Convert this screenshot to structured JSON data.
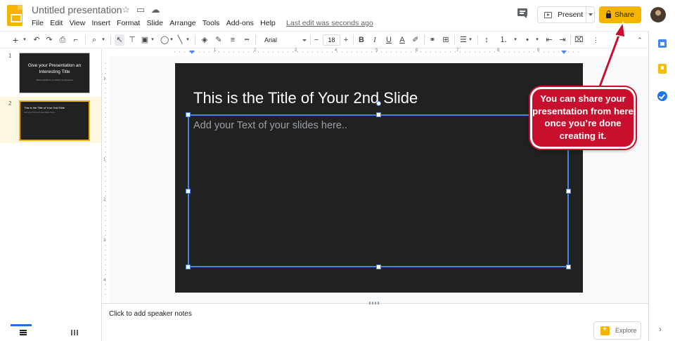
{
  "header": {
    "title": "Untitled presentation",
    "menu": [
      "File",
      "Edit",
      "View",
      "Insert",
      "Format",
      "Slide",
      "Arrange",
      "Tools",
      "Add-ons",
      "Help"
    ],
    "last_edit": "Last edit was seconds ago",
    "present_label": "Present",
    "share_label": "Share"
  },
  "toolbar": {
    "font": "Arial",
    "font_size": "18"
  },
  "filmstrip": {
    "slides": [
      {
        "number": "1",
        "title": "Give your Presentation an Interesting Title",
        "subtitle": "Add a subtitle if you think it is important"
      },
      {
        "number": "2",
        "title": "This is the Title of Your 2nd Slide",
        "subtitle": "Add your Text of your slides here.."
      }
    ]
  },
  "slide": {
    "title": "This is the Title of Your 2nd Slide",
    "body_placeholder": "Add your Text of your slides here.."
  },
  "rulers": {
    "horizontal": [
      "1",
      "2",
      "3",
      "4",
      "5",
      "6",
      "7",
      "8",
      "9"
    ],
    "vertical": [
      "1",
      "1",
      "2",
      "3",
      "4"
    ]
  },
  "notes": {
    "placeholder": "Click to add speaker notes",
    "explore_label": "Explore"
  },
  "callout": {
    "text": "You can share your presentation from here once you’re done creating it.",
    "color": "#c8102e"
  },
  "colors": {
    "share": "#f4b400",
    "selection": "#4a86e8",
    "slide_bg": "#212121"
  }
}
